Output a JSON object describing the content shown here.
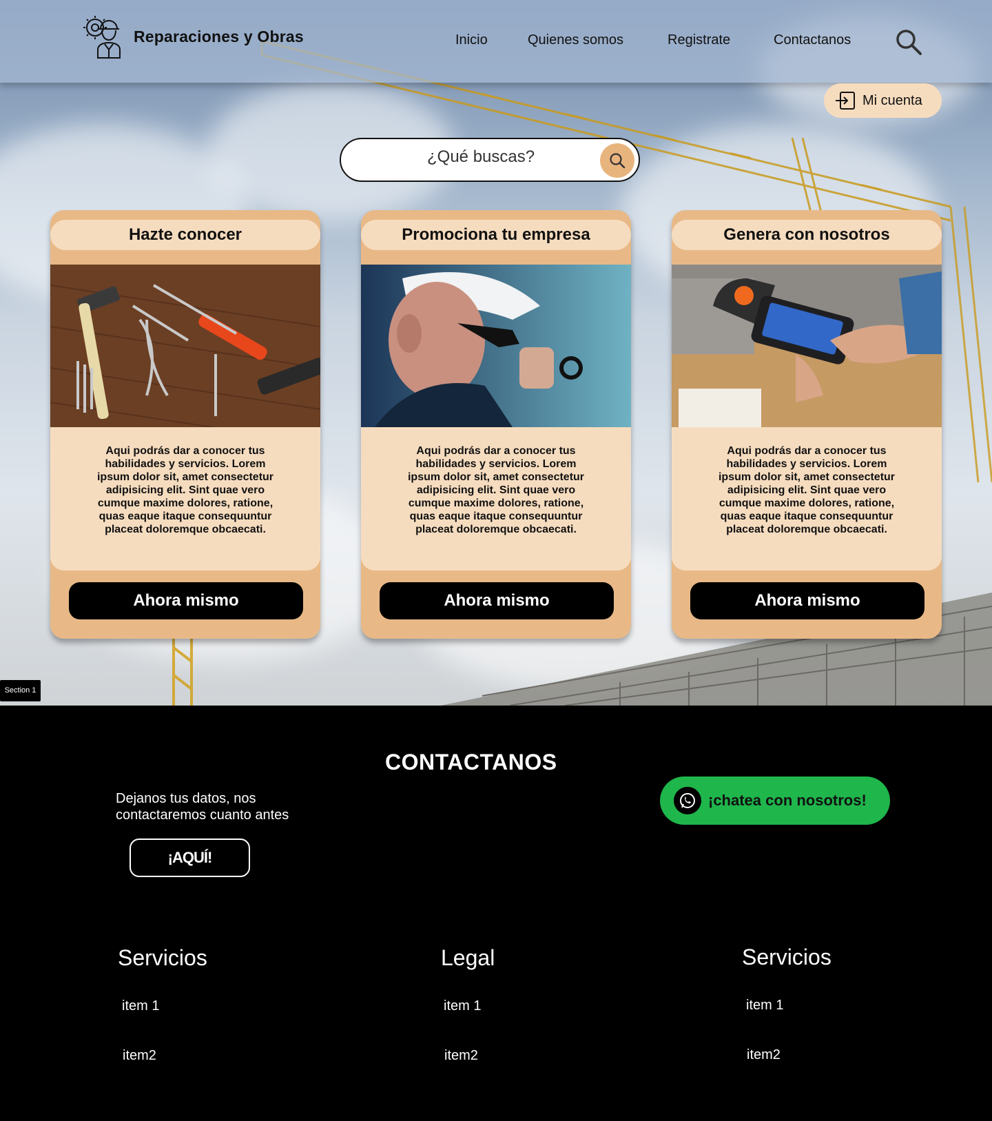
{
  "header": {
    "brand_name": "Reparaciones y Obras",
    "nav": [
      "Inicio",
      "Quienes somos",
      "Registrate",
      "Contactanos"
    ],
    "account_label": "Mi cuenta"
  },
  "search": {
    "placeholder": "¿Qué buscas?"
  },
  "cards": [
    {
      "title": "Hazte conocer",
      "body": "Aqui podrás dar a conocer tus habilidades y servicios. Lorem ipsum dolor sit, amet consectetur adipisicing elit. Sint quae vero cumque maxime dolores, ratione, quas eaque itaque consequuntur placeat doloremque obcaecati.",
      "cta": "Ahora mismo"
    },
    {
      "title": "Promociona tu empresa",
      "body": "Aqui podrás dar a conocer tus habilidades y servicios. Lorem ipsum dolor sit, amet consectetur adipisicing elit. Sint quae vero cumque maxime dolores, ratione, quas eaque itaque consequuntur placeat doloremque obcaecati.",
      "cta": "Ahora mismo"
    },
    {
      "title": "Genera con nosotros",
      "body": "Aqui podrás dar a conocer tus habilidades y servicios. Lorem ipsum dolor sit, amet consectetur adipisicing elit. Sint quae vero cumque maxime dolores, ratione, quas eaque itaque consequuntur placeat doloremque obcaecati.",
      "cta": "Ahora mismo"
    }
  ],
  "section_tag": "Section 1",
  "footer": {
    "contact_title": "CONTACTANOS",
    "contact_text": "Dejanos tus datos, nos contactaremos cuanto antes",
    "aqui_label": "¡AQUÍ!",
    "whatsapp_label": "¡chatea con nosotros!",
    "columns": [
      {
        "title": "Servicios",
        "items": [
          "item 1",
          "item2"
        ]
      },
      {
        "title": "Legal",
        "items": [
          "item 1",
          "item2"
        ]
      },
      {
        "title": "Servicios",
        "items": [
          "item 1",
          "item2"
        ]
      }
    ]
  },
  "colors": {
    "card_bg": "#e8b987",
    "card_light": "#f6dcbf",
    "whatsapp_green": "#1fb64b",
    "search_accent": "#e8b47e"
  },
  "icons": [
    "worker-gear-logo-icon",
    "search-icon",
    "login-icon",
    "whatsapp-icon"
  ]
}
